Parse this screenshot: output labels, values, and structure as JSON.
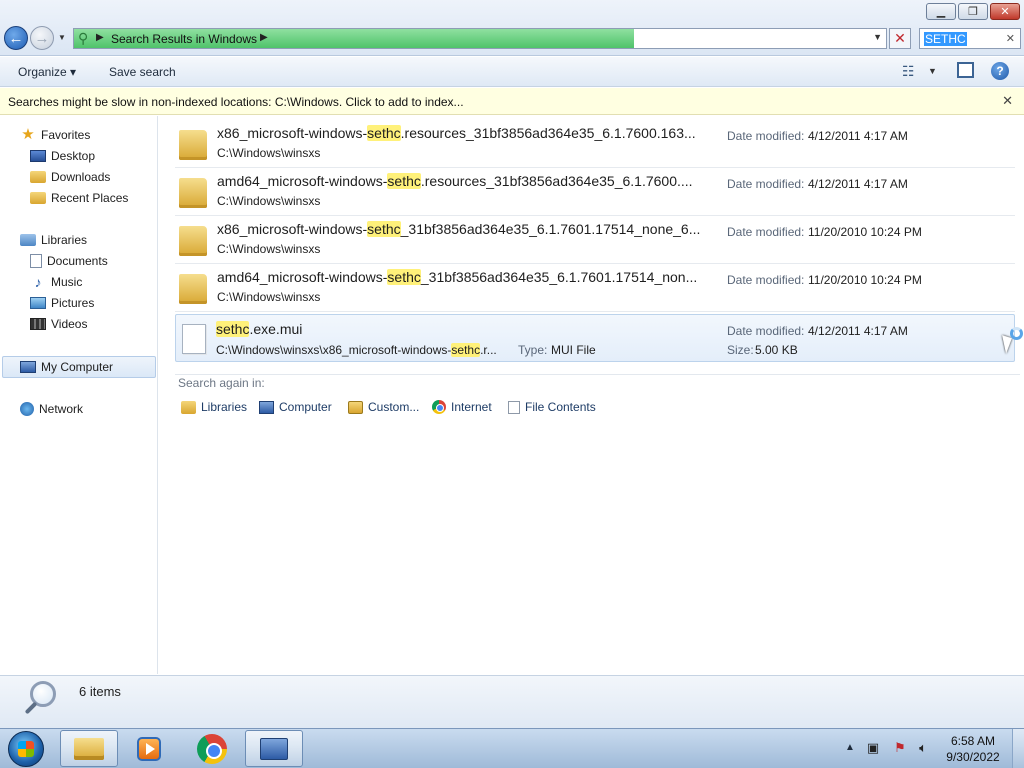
{
  "address": {
    "path": "Search Results in Windows",
    "search_value": "SETHC"
  },
  "toolbar": {
    "organize_label": "Organize",
    "save_search_label": "Save search"
  },
  "infobar": {
    "message": "Searches might be slow in non-indexed locations: C:\\Windows. Click to add to index..."
  },
  "nav": {
    "favorites": "Favorites",
    "desktop": "Desktop",
    "downloads": "Downloads",
    "recent_places": "Recent Places",
    "libraries": "Libraries",
    "documents": "Documents",
    "music": "Music",
    "pictures": "Pictures",
    "videos": "Videos",
    "my_computer": "My Computer",
    "network": "Network"
  },
  "results": [
    {
      "name_pre": "x86_microsoft-windows-",
      "name_hl": "sethc",
      "name_post": ".resources_31bf3856ad364e35_6.1.7600.163...",
      "path": "C:\\Windows\\winsxs",
      "date_label": "Date modified:",
      "date": "4/12/2011 4:17 AM",
      "kind": "folder"
    },
    {
      "name_pre": "amd64_microsoft-windows-",
      "name_hl": "sethc",
      "name_post": ".resources_31bf3856ad364e35_6.1.7600....",
      "path": "C:\\Windows\\winsxs",
      "date_label": "Date modified:",
      "date": "4/12/2011 4:17 AM",
      "kind": "folder"
    },
    {
      "name_pre": "x86_microsoft-windows-",
      "name_hl": "sethc",
      "name_post": "_31bf3856ad364e35_6.1.7601.17514_none_6...",
      "path": "C:\\Windows\\winsxs",
      "date_label": "Date modified:",
      "date": "11/20/2010 10:24 PM",
      "kind": "folder"
    },
    {
      "name_pre": "amd64_microsoft-windows-",
      "name_hl": "sethc",
      "name_post": "_31bf3856ad364e35_6.1.7601.17514_non...",
      "path": "C:\\Windows\\winsxs",
      "date_label": "Date modified:",
      "date": "11/20/2010 10:24 PM",
      "kind": "folder"
    },
    {
      "name_pre": "",
      "name_hl": "sethc",
      "name_post": ".exe.mui",
      "path_pre": "C:\\Windows\\winsxs\\x86_microsoft-windows-",
      "path_hl": "sethc",
      "path_post": ".r...",
      "type_label": "Type:",
      "type": "MUI File",
      "date_label": "Date modified:",
      "date": "4/12/2011 4:17 AM",
      "size_label": "Size:",
      "size": "5.00 KB",
      "kind": "file"
    }
  ],
  "search_again": {
    "label": "Search again in:",
    "libraries": "Libraries",
    "computer": "Computer",
    "custom": "Custom...",
    "internet": "Internet",
    "file_contents": "File Contents"
  },
  "details": {
    "count": "6 items"
  },
  "clock": {
    "time": "6:58 AM",
    "date": "9/30/2022"
  }
}
